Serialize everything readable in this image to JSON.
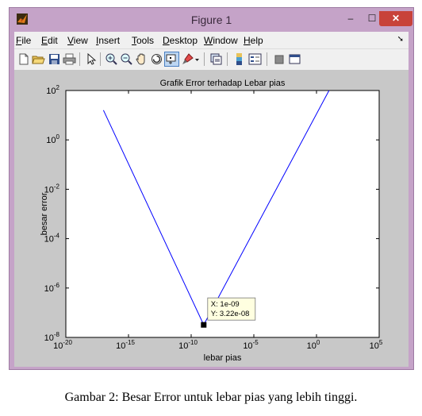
{
  "window": {
    "title": "Figure 1",
    "minimize_label": "–",
    "maximize_label": "☐",
    "close_label": "✕"
  },
  "menu": [
    "File",
    "Edit",
    "View",
    "Insert",
    "Tools",
    "Desktop",
    "Window",
    "Help"
  ],
  "menu_overflow": "➘",
  "toolbar": {
    "icons": [
      "new-figure-icon",
      "open-file-icon",
      "save-icon",
      "print-icon",
      "pointer-icon",
      "zoom-in-icon",
      "zoom-out-icon",
      "pan-icon",
      "rotate-icon",
      "data-cursor-icon",
      "brush-icon",
      "link-plot-icon",
      "colorbar-icon",
      "legend-icon",
      "hide-plot-tools-icon",
      "show-plot-tools-icon"
    ]
  },
  "chart_data": {
    "type": "line",
    "title": "Grafik Error terhadap Lebar pias",
    "xlabel": "lebar pias",
    "ylabel": "besar error",
    "xscale": "log",
    "yscale": "log",
    "xlim": [
      1e-20,
      100000.0
    ],
    "ylim": [
      1e-08,
      100.0
    ],
    "x_ticks": [
      {
        "base": "10",
        "exp": "-20",
        "value": 1e-20
      },
      {
        "base": "10",
        "exp": "-15",
        "value": 1e-15
      },
      {
        "base": "10",
        "exp": "-10",
        "value": 1e-10
      },
      {
        "base": "10",
        "exp": "-5",
        "value": 1e-05
      },
      {
        "base": "10",
        "exp": "0",
        "value": 1
      },
      {
        "base": "10",
        "exp": "5",
        "value": 100000.0
      }
    ],
    "y_ticks": [
      {
        "base": "10",
        "exp": "2",
        "value": 100.0
      },
      {
        "base": "10",
        "exp": "0",
        "value": 1
      },
      {
        "base": "10",
        "exp": "-2",
        "value": 0.01
      },
      {
        "base": "10",
        "exp": "-4",
        "value": 0.0001
      },
      {
        "base": "10",
        "exp": "-6",
        "value": 1e-06
      },
      {
        "base": "10",
        "exp": "-8",
        "value": 1e-08
      }
    ],
    "grid": false,
    "series": [
      {
        "color": "#0000ff",
        "x": [
          1e-17,
          1e-09,
          10.0
        ],
        "y": [
          16,
          3.22e-08,
          100
        ]
      }
    ],
    "datatip": {
      "x": 1e-09,
      "y": 3.22e-08,
      "x_text": "X: 1e-09",
      "y_text": "Y: 3.22e-08"
    }
  },
  "caption": "Gambar 2: Besar Error untuk lebar pias yang lebih tinggi."
}
